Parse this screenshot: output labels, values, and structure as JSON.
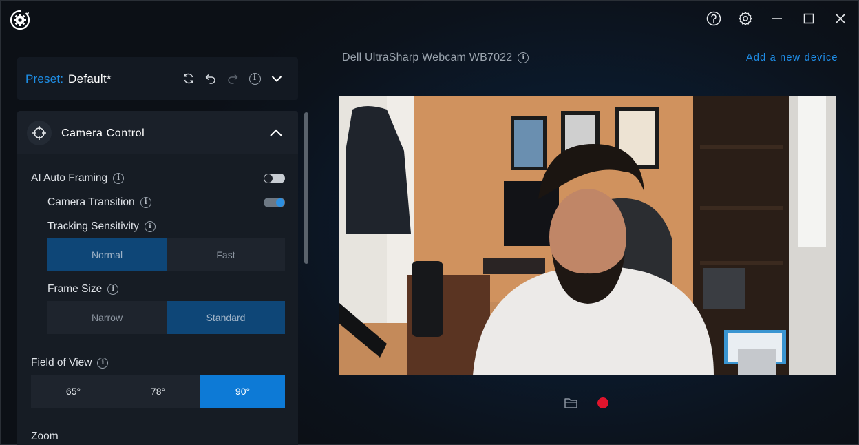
{
  "window": {
    "controls": [
      "help-icon",
      "settings-icon",
      "minimize-icon",
      "maximize-icon",
      "close-icon"
    ]
  },
  "preset": {
    "label": "Preset:",
    "value": "Default*",
    "actions": [
      "refresh-icon",
      "undo-icon",
      "redo-icon",
      "info-icon",
      "chevron-down-icon"
    ]
  },
  "camera_control": {
    "title": "Camera Control",
    "ai_auto_framing": {
      "label": "AI Auto Framing",
      "enabled": false
    },
    "camera_transition": {
      "label": "Camera Transition",
      "enabled": true
    },
    "tracking_sensitivity": {
      "label": "Tracking Sensitivity",
      "options": [
        "Normal",
        "Fast"
      ],
      "selected": "Normal"
    },
    "frame_size": {
      "label": "Frame Size",
      "options": [
        "Narrow",
        "Standard"
      ],
      "selected": "Standard"
    },
    "field_of_view": {
      "label": "Field of View",
      "options": [
        "65°",
        "78°",
        "90°"
      ],
      "selected": "90°"
    },
    "zoom": {
      "label": "Zoom"
    }
  },
  "device": {
    "name": "Dell UltraSharp Webcam WB7022",
    "add_link": "Add a new device"
  },
  "preview": {
    "actions": [
      "folder-icon",
      "record-icon"
    ]
  },
  "colors": {
    "accent": "#1e8ee6",
    "selected_segment": "#0e4677",
    "selected_segment_bright": "#0d7ad6",
    "record": "#e0142c"
  }
}
